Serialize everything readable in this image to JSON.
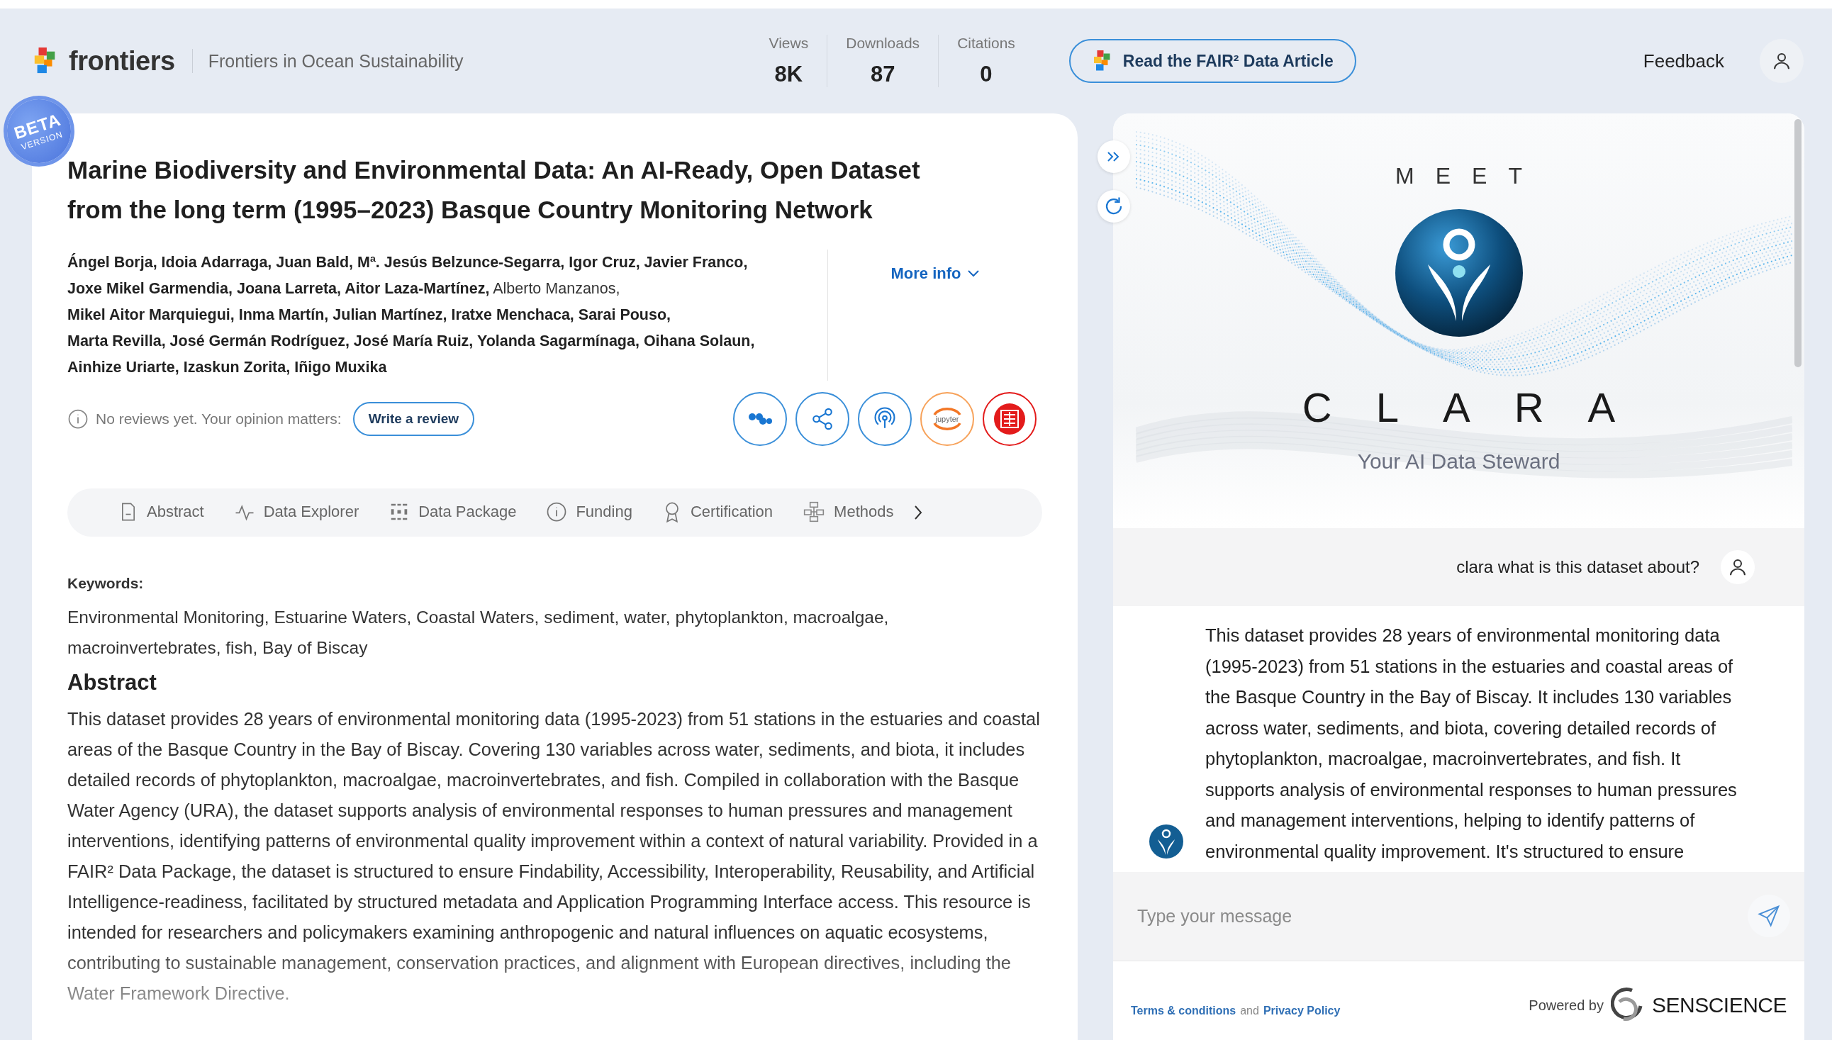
{
  "header": {
    "brand": "frontiers",
    "journal": "Frontiers in Ocean Sustainability",
    "stats": [
      {
        "label": "Views",
        "value": "8K"
      },
      {
        "label": "Downloads",
        "value": "87"
      },
      {
        "label": "Citations",
        "value": "0"
      }
    ],
    "article_button": "Read the FAIR² Data Article",
    "feedback": "Feedback"
  },
  "badge": {
    "line1": "BETA",
    "line2": "VERSION"
  },
  "dataset": {
    "title": "Marine Biodiversity and Environmental Data: An AI-Ready, Open Dataset from the long term (1995–2023) Basque Country Monitoring Network",
    "author_lines": [
      "**Ángel Borja, Idoia Adarraga, Juan Bald, Mª. Jesús Belzunce-Segarra, Igor Cruz, Javier Franco,**",
      "**Joxe Mikel Garmendia, Joana Larreta, Aitor Laza-Martínez,** Alberto Manzanos,",
      "**Mikel Aitor Marquiegui, Inma Martín, Julian Martínez, Iratxe Menchaca, Sarai Pouso,**",
      "**Marta Revilla, José Germán Rodríguez, José María Ruiz, Yolanda Sagarmínaga, Oihana Solaun,**",
      "**Ainhize Uriarte, Izaskun Zorita, Iñigo Muxika**"
    ],
    "more_info": "More info",
    "reviews": {
      "text": "No reviews yet. Your opinion matters:",
      "button": "Write a review"
    },
    "actions": [
      {
        "kind": "cite"
      },
      {
        "kind": "share"
      },
      {
        "kind": "podcast"
      },
      {
        "kind": "jupyter",
        "label": "jupyter"
      },
      {
        "kind": "fair"
      }
    ],
    "tabs": [
      {
        "label": "Abstract",
        "kind": "document",
        "selected": false
      },
      {
        "label": "Data Explorer",
        "kind": "pulse",
        "selected": false
      },
      {
        "label": "Data Package",
        "kind": "grid",
        "selected": false
      },
      {
        "label": "Funding",
        "kind": "info",
        "selected": false
      },
      {
        "label": "Certification",
        "kind": "award",
        "selected": false
      },
      {
        "label": "Methods",
        "kind": "flow",
        "selected": false
      }
    ],
    "keywords_label": "Keywords:",
    "keywords": "Environmental Monitoring, Estuarine Waters, Coastal Waters, sediment, water, phytoplankton, macroalgae, macroinvertebrates, fish, Bay of Biscay",
    "abstract_heading": "Abstract",
    "abstract": "This dataset provides 28 years of environmental monitoring data (1995-2023) from 51 stations in the estuaries and coastal areas of the Basque Country in the Bay of Biscay. Covering 130 variables across water, sediments, and biota, it includes detailed records of phytoplankton, macroalgae, macroinvertebrates, and fish. Compiled in collaboration with the Basque Water Agency (URA), the dataset supports analysis of environmental responses to human pressures and management interventions, identifying patterns of environmental quality improvement within a context of natural variability. Provided in a FAIR² Data Package, the dataset is structured to ensure Findability, Accessibility, Interoperability, Reusability, and Artificial Intelligence-readiness, facilitated by structured metadata and Application Programming Interface access. This resource is intended for researchers and policymakers examining anthropogenic and natural influences on aquatic ecosystems, contributing to sustainable management, conservation practices, and alignment with European directives, including the Water Framework Directive."
  },
  "assistant": {
    "meet": "MEET",
    "name": "CLARA",
    "tagline": "Your AI Data Steward",
    "messages": [
      {
        "kind": "user",
        "text": "clara what is this dataset about?"
      },
      {
        "kind": "bot",
        "text": "This dataset provides 28 years of environmental monitoring data (1995-2023) from 51 stations in the estuaries and coastal areas of the Basque Country in the Bay of Biscay. It includes 130 variables across water, sediments, and biota, covering detailed records of phytoplankton, macroalgae, macroinvertebrates, and fish. It supports analysis of environmental responses to human pressures and management interventions, helping to identify patterns of environmental quality improvement. It's structured to ensure"
      }
    ],
    "input_placeholder": "Type your message",
    "footer": {
      "terms": "Terms & conditions",
      "and": "and",
      "privacy": "Privacy Policy",
      "powered_by": "Powered by",
      "company": "SENSCIENCE"
    }
  }
}
